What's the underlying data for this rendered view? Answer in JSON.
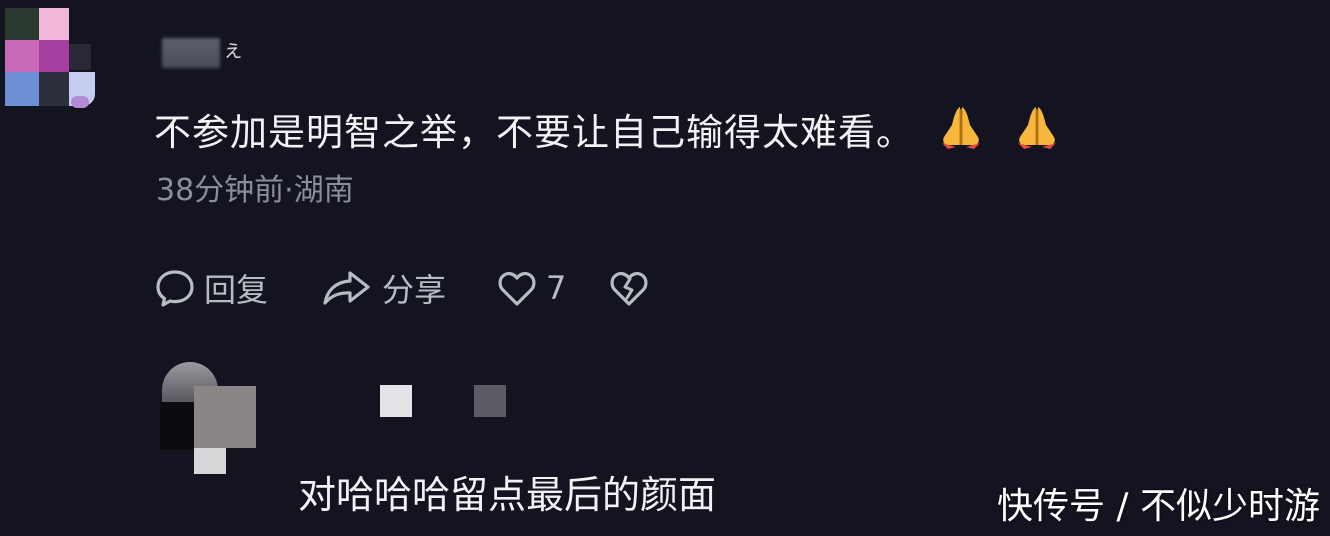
{
  "comment": {
    "username_suffix": "ぇ",
    "text": "不参加是明智之举，不要让自己输得太难看。",
    "emoji": [
      "folded-hands-emoji",
      "folded-hands-emoji"
    ],
    "meta": "38分钟前·湖南",
    "actions": {
      "reply_label": "回复",
      "share_label": "分享",
      "like_count": "7"
    }
  },
  "reply": {
    "text": "对哈哈哈留点最后的颜面"
  },
  "watermark": "快传号 / 不似少时游",
  "colors": {
    "background": "#13141f",
    "primary_text": "#f2f2f5",
    "secondary_text": "#8b8d99",
    "action_text": "#b8bac4"
  }
}
